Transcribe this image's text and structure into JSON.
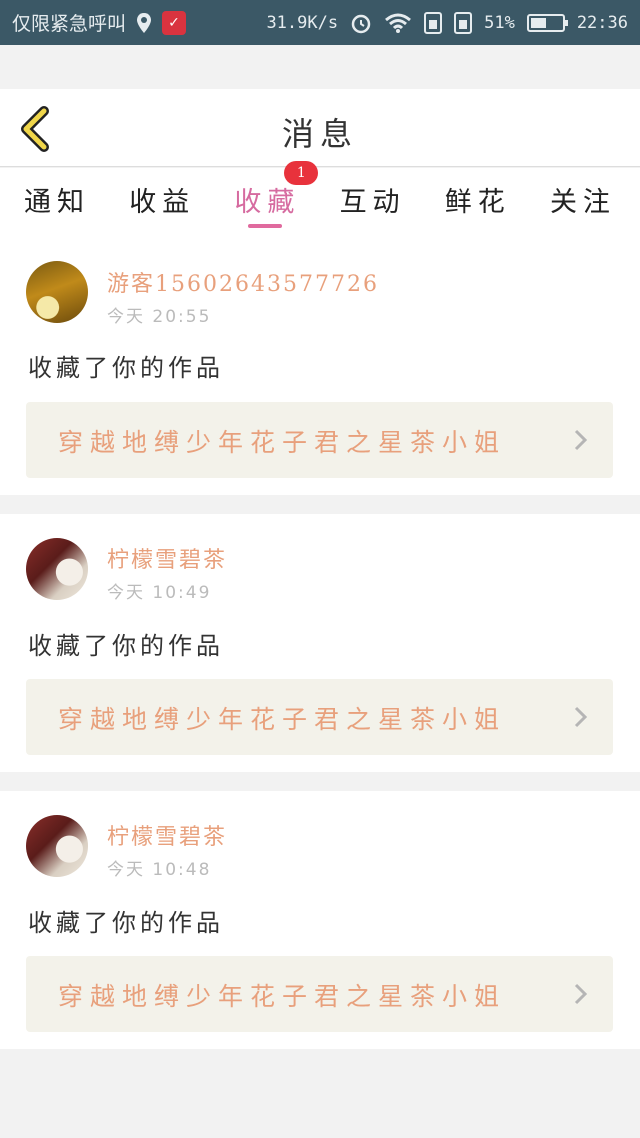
{
  "status_bar": {
    "carrier": "仅限紧急呼叫",
    "speed": "31.9K/s",
    "battery": "51%",
    "time": "22:36",
    "battery_level": 0.51
  },
  "header": {
    "title": "消息"
  },
  "tabs": [
    {
      "label": "通知"
    },
    {
      "label": "收益"
    },
    {
      "label": "收藏",
      "badge": "1"
    },
    {
      "label": "互动"
    },
    {
      "label": "鲜花"
    },
    {
      "label": "关注"
    }
  ],
  "messages": [
    {
      "username": "游客15602643577726",
      "time": "今天 20:55",
      "action": "收藏了你的作品",
      "work_title": "穿越地缚少年花子君之星茶小姐"
    },
    {
      "username": "柠檬雪碧茶",
      "time": "今天 10:49",
      "action": "收藏了你的作品",
      "work_title": "穿越地缚少年花子君之星茶小姐"
    },
    {
      "username": "柠檬雪碧茶",
      "time": "今天 10:48",
      "action": "收藏了你的作品",
      "work_title": "穿越地缚少年花子君之星茶小姐"
    }
  ],
  "colors": {
    "status_bar": "#3b5866",
    "accent_pink": "#e06a9e",
    "username": "#e8a07c",
    "badge": "#e8323c",
    "back_arrow": "#f0d64a"
  }
}
